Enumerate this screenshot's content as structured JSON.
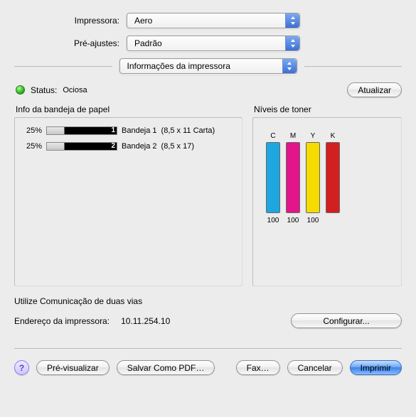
{
  "labels": {
    "printer": "Impressora:",
    "presets": "Pré-ajustes:"
  },
  "printer_value": "Aero",
  "presets_value": "Padrão",
  "category_value": "Informações da impressora",
  "status": {
    "label": "Status:",
    "value": "Ociosa",
    "color": "#2fbf20",
    "refresh_button": "Atualizar"
  },
  "tray_panel": {
    "title": "Info da bandeja de papel",
    "rows": [
      {
        "pct": "25%",
        "fill": 25,
        "num": "1",
        "name": "Bandeja 1",
        "spec": "(8,5 x 11 Carta)"
      },
      {
        "pct": "25%",
        "fill": 25,
        "num": "2",
        "name": "Bandeja 2",
        "spec": "(8,5 x 17)"
      }
    ]
  },
  "toner_panel": {
    "title": "Níveis de toner",
    "bars": [
      {
        "label": "C",
        "value": "100",
        "fill": 100,
        "color": "#1ea6e0"
      },
      {
        "label": "M",
        "value": "100",
        "fill": 100,
        "color": "#e4148b"
      },
      {
        "label": "Y",
        "value": "100",
        "fill": 100,
        "color": "#f5db00"
      },
      {
        "label": "K",
        "value": "",
        "fill": 100,
        "color": "#d21f1f"
      }
    ]
  },
  "twoway": {
    "title": "Utilize Comunicação de duas vias",
    "addr_label": "Endereço da impressora:",
    "addr_value": "10.11.254.10",
    "configure_button": "Configurar..."
  },
  "footer": {
    "help": "?",
    "preview": "Pré-visualizar",
    "save_pdf": "Salvar Como PDF…",
    "fax": "Fax…",
    "cancel": "Cancelar",
    "print": "Imprimir"
  },
  "chart_data": {
    "type": "bar",
    "categories": [
      "C",
      "M",
      "Y",
      "K"
    ],
    "values": [
      100,
      100,
      100,
      100
    ],
    "title": "Níveis de toner",
    "xlabel": "",
    "ylabel": "",
    "ylim": [
      0,
      100
    ]
  }
}
